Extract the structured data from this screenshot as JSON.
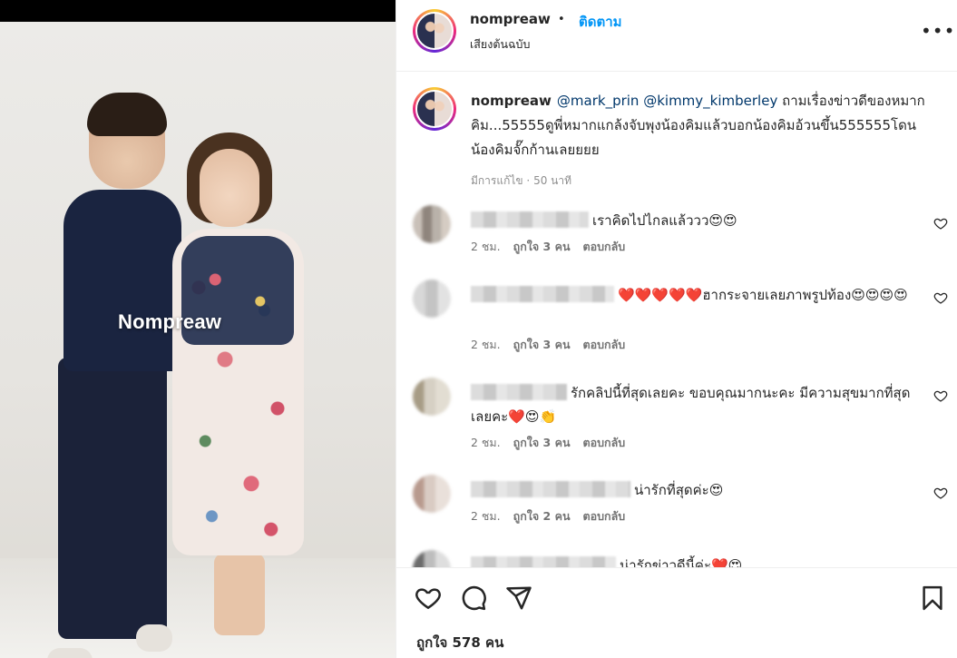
{
  "media": {
    "watermark": "Nompreaw"
  },
  "header": {
    "username": "nompreaw",
    "separator": "•",
    "follow_label": "ติดตาม",
    "audio": "เสียงต้นฉบับ",
    "more": "•••"
  },
  "caption": {
    "username": "nompreaw",
    "mention1": "@mark_prin",
    "mention2": "@kimmy_kimberley",
    "text": "ถามเรื่องข่าวดีของหมากคิม...55555ดูพี่หมากแกล้งจับพุงน้องคิมแล้วบอกน้องคิมอ้วนขึ้น555555โดนน้องคิมจั๊กก้านเลยยยย",
    "edited": "มีการแก้ไข",
    "time": "50 นาที"
  },
  "comments": [
    {
      "text": "เราคิดไปไกลแล้ววว😍😍",
      "time": "2 ชม.",
      "likes": "ถูกใจ 3 คน",
      "reply": "ตอบกลับ"
    },
    {
      "text": "❤️❤️❤️❤️❤️ฮากระจายเลยภาพรูปท้อง😍😍😍😍",
      "time": "2 ชม.",
      "likes": "ถูกใจ 3 คน",
      "reply": "ตอบกลับ"
    },
    {
      "text": "รักคลิปนี้ที่สุดเลยคะ ขอบคุณมากนะคะ มีความสุขมากที่สุดเลยคะ❤️😍👏",
      "time": "2 ชม.",
      "likes": "ถูกใจ 3 คน",
      "reply": "ตอบกลับ"
    },
    {
      "text": "น่ารักที่สุดค่ะ😍",
      "time": "2 ชม.",
      "likes": "ถูกใจ 2 คน",
      "reply": "ตอบกลับ"
    },
    {
      "text": "น่ารักข่าวดีนี้ค่ะ❤️😍"
    }
  ],
  "footer": {
    "likes": "ถูกใจ 578 คน"
  }
}
